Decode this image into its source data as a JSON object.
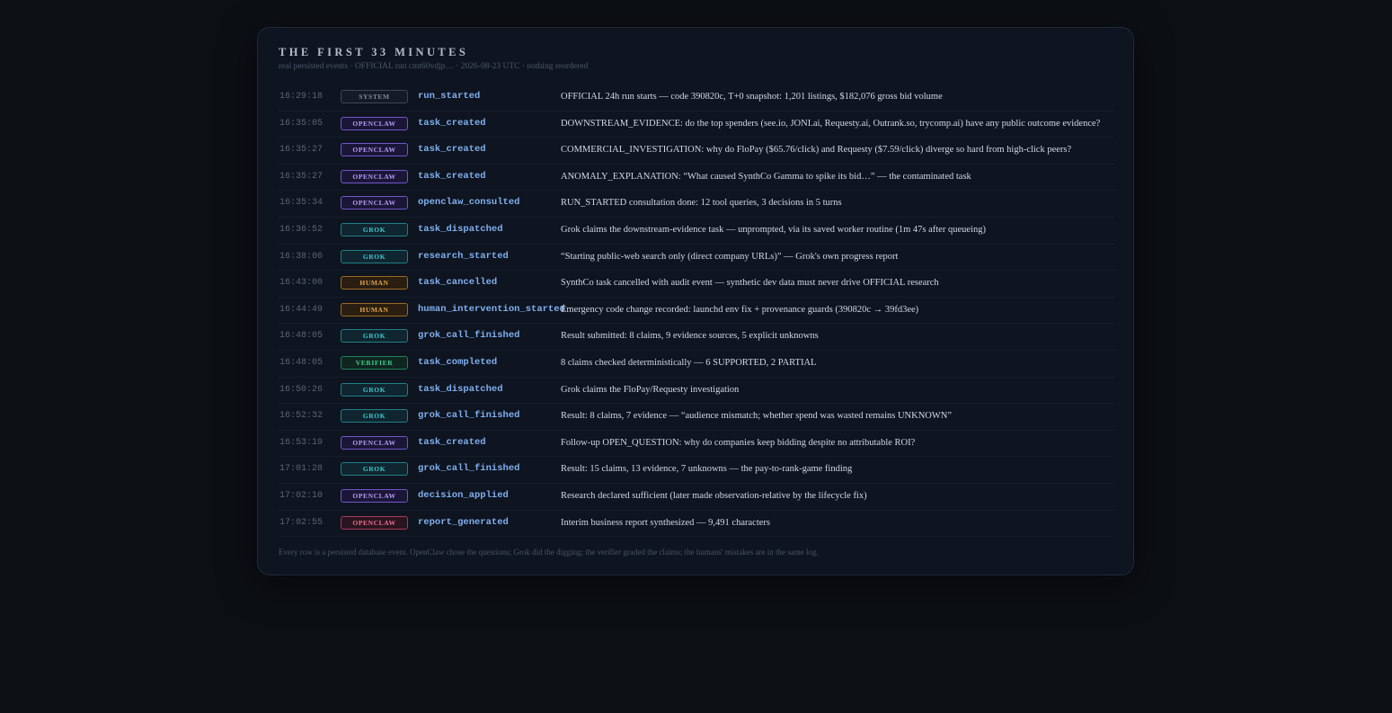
{
  "panel": {
    "title": "THE FIRST 33 MINUTES",
    "subtitle": "real persisted events · OFFICIAL run cmt60vdjp… · 2026-08-23 UTC · nothing reordered",
    "footer": "Every row is a persisted database event. OpenClaw chose the questions; Grok did the digging; the verifier graded the claims; the humans' mistakes are in the same log."
  },
  "colors": {
    "background": "#0c0f14",
    "panel": "#0e1420",
    "system": "#7f8898",
    "openclaw": "#b69cf2",
    "grok": "#3ec7d2",
    "human": "#e2a646",
    "verifier": "#3fcf8e",
    "report": "#ef6f8e",
    "event_name": "#7fb0ef"
  },
  "events": [
    {
      "time": "16:29:18",
      "actor": "SYSTEM",
      "event": "run_started",
      "description": "OFFICIAL 24h run starts — code 390820c, T+0 snapshot: 1,201 listings, $182,076 gross bid volume"
    },
    {
      "time": "16:35:05",
      "actor": "OPENCLAW",
      "event": "task_created",
      "description": "DOWNSTREAM_EVIDENCE: do the top spenders (see.io, JONI.ai, Requesty.ai, Outrank.so, trycomp.ai) have any public outcome evidence?"
    },
    {
      "time": "16:35:27",
      "actor": "OPENCLAW",
      "event": "task_created",
      "description": "COMMERCIAL_INVESTIGATION: why do FloPay ($65.76/click) and Requesty ($7.59/click) diverge so hard from high-click peers?"
    },
    {
      "time": "16:35:27",
      "actor": "OPENCLAW",
      "event": "task_created",
      "description": "ANOMALY_EXPLANATION: “What caused SynthCo Gamma to spike its bid…” — the contaminated task"
    },
    {
      "time": "16:35:34",
      "actor": "OPENCLAW",
      "event": "openclaw_consulted",
      "description": "RUN_STARTED consultation done: 12 tool queries, 3 decisions in 5 turns"
    },
    {
      "time": "16:36:52",
      "actor": "GROK",
      "event": "task_dispatched",
      "description": "Grok claims the downstream-evidence task — unprompted, via its saved worker routine (1m 47s after queueing)"
    },
    {
      "time": "16:38:06",
      "actor": "GROK",
      "event": "research_started",
      "description": "“Starting public-web search only (direct company URLs)” — Grok's own progress report"
    },
    {
      "time": "16:43:00",
      "actor": "HUMAN",
      "event": "task_cancelled",
      "description": "SynthCo task cancelled with audit event — synthetic dev data must never drive OFFICIAL research"
    },
    {
      "time": "16:44:49",
      "actor": "HUMAN",
      "event": "human_intervention_started",
      "description": "Emergency code change recorded: launchd env fix + provenance guards (390820c → 39fd3ee)"
    },
    {
      "time": "16:48:05",
      "actor": "GROK",
      "event": "grok_call_finished",
      "description": "Result submitted: 8 claims, 9 evidence sources, 5 explicit unknowns"
    },
    {
      "time": "16:48:05",
      "actor": "VERIFIER",
      "event": "task_completed",
      "description": "8 claims checked deterministically — 6 SUPPORTED, 2 PARTIAL"
    },
    {
      "time": "16:50:26",
      "actor": "GROK",
      "event": "task_dispatched",
      "description": "Grok claims the FloPay/Requesty investigation"
    },
    {
      "time": "16:52:32",
      "actor": "GROK",
      "event": "grok_call_finished",
      "description": "Result: 8 claims, 7 evidence — “audience mismatch; whether spend was wasted remains UNKNOWN”"
    },
    {
      "time": "16:53:19",
      "actor": "OPENCLAW",
      "event": "task_created",
      "description": "Follow-up OPEN_QUESTION: why do companies keep bidding despite no attributable ROI?"
    },
    {
      "time": "17:01:28",
      "actor": "GROK",
      "event": "grok_call_finished",
      "description": "Result: 15 claims, 13 evidence, 7 unknowns — the pay-to-rank-game finding"
    },
    {
      "time": "17:02:10",
      "actor": "OPENCLAW",
      "event": "decision_applied",
      "description": "Research declared sufficient (later made observation-relative by the lifecycle fix)"
    },
    {
      "time": "17:02:55",
      "actor": "OPENCLAW",
      "event": "report_generated",
      "description": "Interim business report synthesized — 9,491 characters"
    }
  ]
}
